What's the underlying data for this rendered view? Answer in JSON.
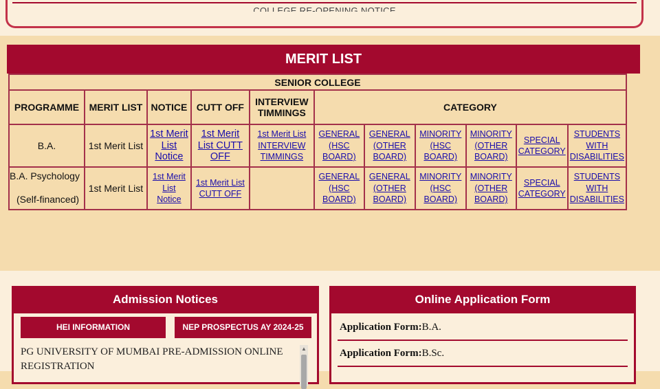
{
  "top_notice": {
    "text": "COLLEGE RE-OPENING NOTICE"
  },
  "merit": {
    "title": "MERIT LIST",
    "section": "SENIOR COLLEGE",
    "headers": {
      "programme": "PROGRAMME",
      "merit_list": "MERIT LIST",
      "notice": "NOTICE",
      "cutt_off": "CUTT OFF",
      "interview": "INTERVIEW TIMMINGS",
      "category": "CATEGORY"
    },
    "rows": [
      {
        "programme": "B.A.",
        "programme_sub": "",
        "merit_list": "1st Merit List",
        "notice": "1st Merit List Notice",
        "cutt_off": "1st Merit List CUTT OFF",
        "interview": "1st Merit List INTERVIEW TIMMINGS",
        "categories": [
          "GENERAL (HSC BOARD)",
          "GENERAL (OTHER BOARD)",
          "MINORITY (HSC BOARD)",
          "MINORITY (OTHER BOARD)",
          "SPECIAL CATEGORY",
          "STUDENTS WITH DISABILITIES"
        ]
      },
      {
        "programme": "B.A. Psychology",
        "programme_sub": "(Self-financed)",
        "merit_list": "1st Merit List",
        "notice": "1st Merit List Notice",
        "cutt_off": "1st Merit List  CUTT OFF",
        "interview": "",
        "categories": [
          "GENERAL (HSC BOARD)",
          "GENERAL (OTHER BOARD)",
          "MINORITY (HSC BOARD)",
          "MINORITY (OTHER BOARD)",
          "SPECIAL CATEGORY",
          "STUDENTS WITH DISABILITIES"
        ]
      }
    ]
  },
  "admission": {
    "title": "Admission Notices",
    "btn_hei": "HEI INFORMATION",
    "btn_nep": "NEP PROSPECTUS AY 2024-25",
    "item": "PG UNIVERSITY OF MUMBAI PRE-ADMISSION ONLINE REGISTRATION"
  },
  "online_form": {
    "title": "Online Application Form",
    "items": [
      {
        "label": "Application Form:",
        "value": "B.A."
      },
      {
        "label": "Application Form:",
        "value": "B.Sc."
      }
    ]
  },
  "colors": {
    "brand": "#a3092e",
    "bg": "#f5dcae",
    "panel_bg": "#fbefdc",
    "link": "#1a0dab"
  }
}
